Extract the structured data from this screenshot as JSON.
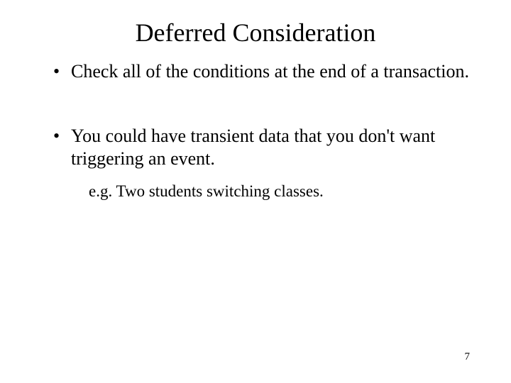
{
  "title": "Deferred Consideration",
  "bullets": {
    "item1": "Check all of the conditions at the end of a transaction.",
    "item2": "You could have transient data that you don't want triggering an event.",
    "sub1": "e.g. Two students switching classes."
  },
  "page_number": "7"
}
